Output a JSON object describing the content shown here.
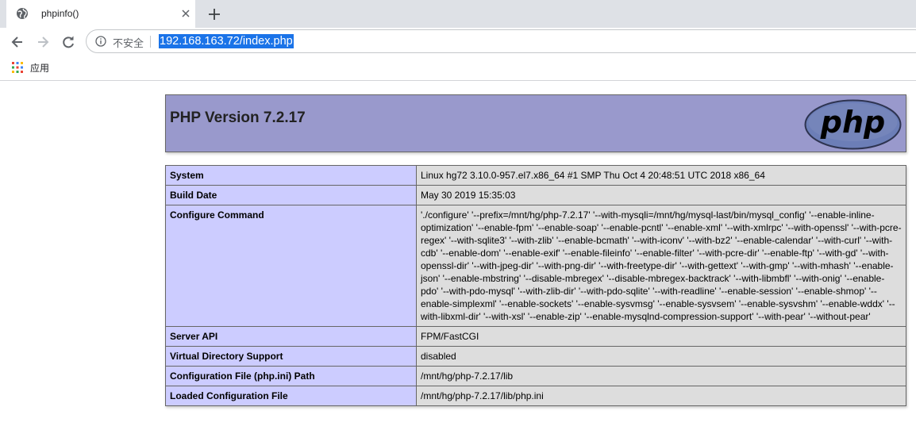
{
  "browser": {
    "tab_title": "phpinfo()",
    "security_label": "不安全",
    "url": "192.168.163.72/index.php",
    "bookmarks": [
      {
        "label": "应用"
      }
    ]
  },
  "page": {
    "header": {
      "title": "PHP Version 7.2.17",
      "logo_text": "php"
    },
    "rows": [
      {
        "label": "System",
        "value": "Linux hg72 3.10.0-957.el7.x86_64 #1 SMP Thu Oct 4 20:48:51 UTC 2018 x86_64"
      },
      {
        "label": "Build Date",
        "value": "May 30 2019 15:35:03"
      },
      {
        "label": "Configure Command",
        "value": "'./configure' '--prefix=/mnt/hg/php-7.2.17' '--with-mysqli=/mnt/hg/mysql-last/bin/mysql_config' '--enable-inline-optimization' '--enable-fpm' '--enable-soap' '--enable-pcntl' '--enable-xml' '--with-xmlrpc' '--with-openssl' '--with-pcre-regex' '--with-sqlite3' '--with-zlib' '--enable-bcmath' '--with-iconv' '--with-bz2' '--enable-calendar' '--with-curl' '--with-cdb' '--enable-dom' '--enable-exif' '--enable-fileinfo' '--enable-filter' '--with-pcre-dir' '--enable-ftp' '--with-gd' '--with-openssl-dir' '--with-jpeg-dir' '--with-png-dir' '--with-freetype-dir' '--with-gettext' '--with-gmp' '--with-mhash' '--enable-json' '--enable-mbstring' '--disable-mbregex' '--disable-mbregex-backtrack' '--with-libmbfl' '--with-onig' '--enable-pdo' '--with-pdo-mysql' '--with-zlib-dir' '--with-pdo-sqlite' '--with-readline' '--enable-session' '--enable-shmop' '--enable-simplexml' '--enable-sockets' '--enable-sysvmsg' '--enable-sysvsem' '--enable-sysvshm' '--enable-wddx' '--with-libxml-dir' '--with-xsl' '--enable-zip' '--enable-mysqlnd-compression-support' '--with-pear' '--without-pear'"
      },
      {
        "label": "Server API",
        "value": "FPM/FastCGI"
      },
      {
        "label": "Virtual Directory Support",
        "value": "disabled"
      },
      {
        "label": "Configuration File (php.ini) Path",
        "value": "/mnt/hg/php-7.2.17/lib"
      },
      {
        "label": "Loaded Configuration File",
        "value": "/mnt/hg/php-7.2.17/lib/php.ini"
      }
    ]
  },
  "icons": {
    "tab_favicon": "globe-icon",
    "tab_close": "close-icon",
    "new_tab": "plus-icon",
    "back": "back-arrow-icon",
    "forward": "forward-arrow-icon",
    "reload": "reload-icon",
    "site_info": "info-icon",
    "apps": "apps-grid-icon"
  },
  "colors": {
    "header_bg": "#9999cc",
    "label_cell_bg": "#ccccff",
    "value_cell_bg": "#dddddd",
    "url_highlight": "#1a73e8",
    "logo_purple": "#6c7eb7"
  }
}
